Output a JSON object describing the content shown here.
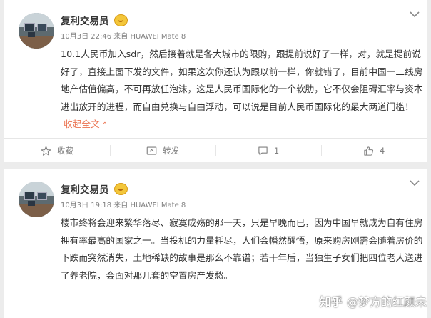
{
  "posts": [
    {
      "author": "复利交易员",
      "time": "10月3日 22:46 来自 HUAWEI Mate 8",
      "text": "10.1人民币加入sdr，然后接着就是各大城市的限购，跟提前说好了一样，对，就是提前说好了，直接上面下发的文件，如果这次你还认为跟以前一样，你就错了，目前中国一二线房地产估值偏高，不可再放任泡沫，这是人民币国际化的一个软肋，它不仅会阻碍汇率与资本进出放开的进程，而自由兑换与自由浮动，可以说是目前人民币国际化的最大两道门槛！",
      "collapse_label": "收起全文",
      "actions": {
        "favorite": "收藏",
        "repost": "转发",
        "comment_count": "1",
        "like_count": "4"
      }
    },
    {
      "author": "复利交易员",
      "time": "10月3日 19:18 来自 HUAWEI Mate 8",
      "text": "楼市终将会迎来繁华落尽、寂寞成殇的那一天，只是早晚而已，因为中国早就成为自有住房拥有率最高的国家之一。当投机的力量耗尽，人们会幡然醒悟，原来购房刚需会随着房价的下跌而突然消失，土地稀缺的故事是那么不靠谱；若干年后，当独生子女们把四位老人送进了养老院，会面对那几套的空置房产发愁。"
    }
  ],
  "watermark": {
    "site": "知乎",
    "author": "@梦方的红颜未"
  },
  "colors": {
    "accent": "#eb7350",
    "meta": "#808080",
    "background": "#ececec"
  }
}
